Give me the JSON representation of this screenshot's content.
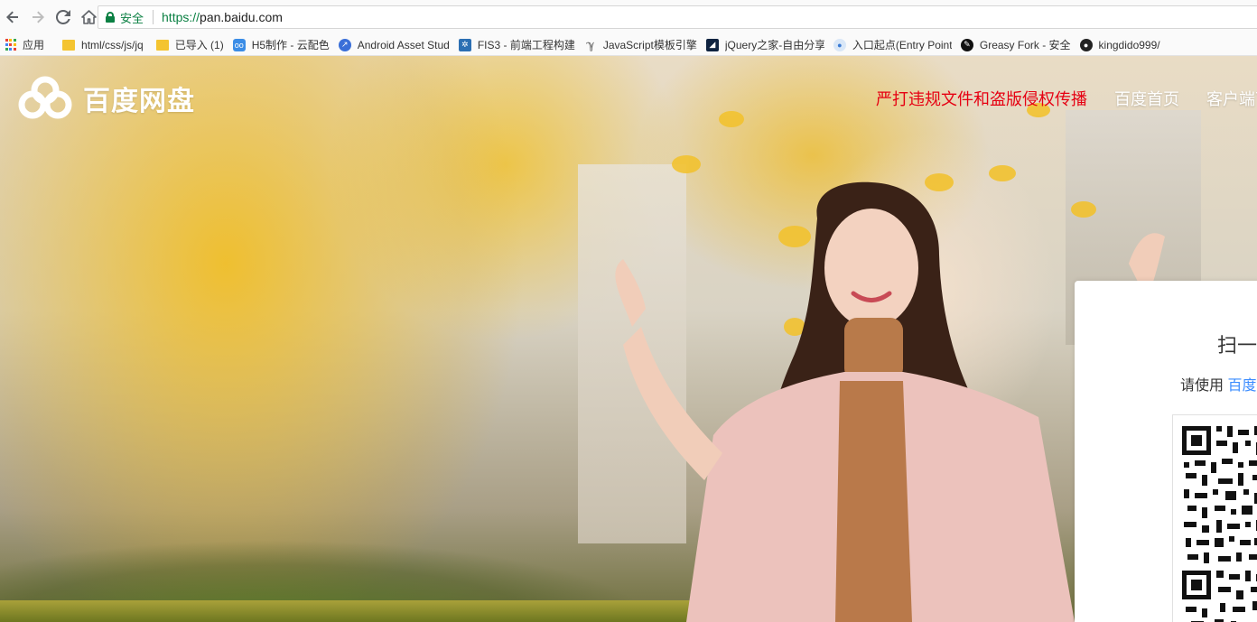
{
  "browser": {
    "security_label": "安全",
    "url_scheme": "https://",
    "url_host": "pan.baidu.com"
  },
  "bookmarks": [
    {
      "label": "应用",
      "icon": "apps-grid-icon"
    },
    {
      "label": "html/css/js/jq",
      "icon": "folder-icon"
    },
    {
      "label": "已导入 (1)",
      "icon": "folder-icon"
    },
    {
      "label": "H5制作 - 云配色",
      "icon": "h5-icon"
    },
    {
      "label": "Android Asset Stud",
      "icon": "android-asset-icon"
    },
    {
      "label": "FIS3 - 前端工程构建",
      "icon": "fis-icon"
    },
    {
      "label": "JavaScript模板引擎",
      "icon": "js-template-icon"
    },
    {
      "label": "jQuery之家-自由分享",
      "icon": "jquery-home-icon"
    },
    {
      "label": "入口起点(Entry Point",
      "icon": "entry-point-icon"
    },
    {
      "label": "Greasy Fork - 安全",
      "icon": "greasy-fork-icon"
    },
    {
      "label": "kingdido999/",
      "icon": "github-icon"
    }
  ],
  "header": {
    "logo_text": "百度网盘",
    "nav": {
      "report": "严打违规文件和盗版侵权传播",
      "home": "百度首页",
      "client": "客户端下"
    }
  },
  "login_panel": {
    "title": "扫一",
    "hint_prefix": "请使用 ",
    "hint_link": "百度"
  },
  "colors": {
    "report_red": "#e60012",
    "secure_green": "#0b8043",
    "link_blue": "#3b8cff"
  }
}
